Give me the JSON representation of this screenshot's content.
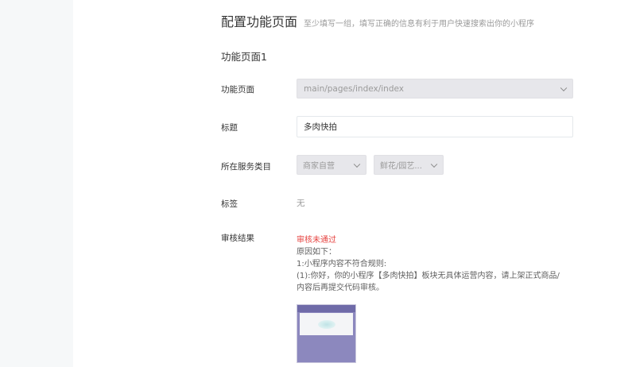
{
  "heading": {
    "title": "配置功能页面",
    "hint": "至少填写一组，填写正确的信息有利于用户快速搜索出你的小程序"
  },
  "section": {
    "title": "功能页面1"
  },
  "form": {
    "page": {
      "label": "功能页面",
      "value": "main/pages/index/index"
    },
    "title": {
      "label": "标题",
      "value": "多肉快拍"
    },
    "category": {
      "label": "所在服务类目",
      "primary": "商家自营",
      "secondary": "鲜花/园艺..."
    },
    "tags": {
      "label": "标签",
      "value": "无"
    },
    "review": {
      "label": "审核结果",
      "status": "审核未通过",
      "status_color": "#e64340",
      "reason_lines": [
        "原因如下：",
        "1:小程序内容不符合规则:",
        "(1):你好，你的小程序【多肉快拍】板块无具体运营内容，请上架正式商品/",
        "内容后再提交代码审核。"
      ]
    }
  },
  "icons": {
    "select_chevron": "chevron-down-icon"
  }
}
